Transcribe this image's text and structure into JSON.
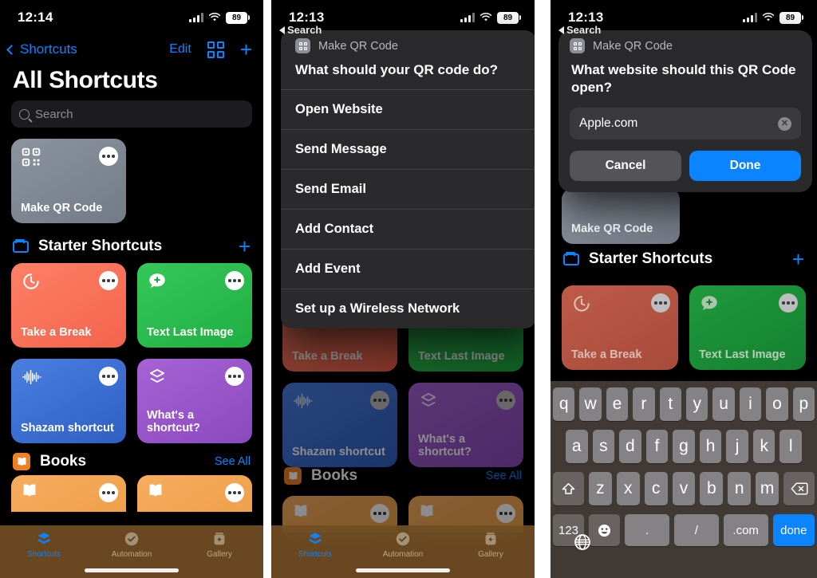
{
  "panels": [
    {
      "id": "panel-all-shortcuts",
      "status": {
        "time": "12:14",
        "battery": "89"
      },
      "nav": {
        "back_label": "Shortcuts",
        "edit_label": "Edit",
        "grid_icon": "grid-view-icon",
        "add_icon": "plus-icon"
      },
      "title": "All Shortcuts",
      "search_placeholder": "Search",
      "my_shortcuts": [
        {
          "label": "Make QR Code",
          "icon": "qr-code-icon",
          "color": "#7d8590"
        }
      ],
      "section_starter": {
        "title": "Starter Shortcuts",
        "icon": "folder-icon",
        "action_icon": "plus-icon"
      },
      "starter_shortcuts": [
        {
          "label": "Take a Break",
          "icon": "timer-icon",
          "color": "#fc7058"
        },
        {
          "label": "Text Last Image",
          "icon": "message-plus-icon",
          "color": "#2dbe4e"
        },
        {
          "label": "Shazam shortcut",
          "icon": "waveform-icon",
          "color": "#3b6fd4"
        },
        {
          "label": "What's a shortcut?",
          "icon": "layers-icon",
          "color": "#9a56c9"
        }
      ],
      "section_books": {
        "title": "Books",
        "icon": "books-app-icon",
        "see_all": "See All"
      },
      "books_shortcuts": [
        {
          "label": "",
          "color": "#f2a04a"
        },
        {
          "label": "",
          "color": "#f2a04a"
        }
      ],
      "tabs": [
        {
          "label": "Shortcuts",
          "icon": "shortcuts-tab-icon",
          "active": true
        },
        {
          "label": "Automation",
          "icon": "automation-tab-icon",
          "active": false
        },
        {
          "label": "Gallery",
          "icon": "gallery-tab-icon",
          "active": false
        }
      ]
    },
    {
      "id": "panel-action-sheet",
      "status": {
        "time": "12:13",
        "battery": "89"
      },
      "back_crumb": "Search",
      "sheet": {
        "app_name": "Make QR Code",
        "app_icon": "qr-code-icon",
        "question": "What should your QR code do?",
        "options": [
          "Open Website",
          "Send Message",
          "Send Email",
          "Add Contact",
          "Add Event",
          "Set up a Wireless Network"
        ]
      },
      "section_books": {
        "title": "Books",
        "see_all": "See All"
      },
      "starter_shortcuts": [
        {
          "label": "Take a Break",
          "color": "#fc7058"
        },
        {
          "label": "Text Last Image",
          "color": "#2dbe4e"
        },
        {
          "label": "Shazam shortcut",
          "color": "#3b6fd4"
        },
        {
          "label": "What's a shortcut?",
          "color": "#9a56c9"
        }
      ],
      "tabs": [
        {
          "label": "Shortcuts",
          "active": true
        },
        {
          "label": "Automation",
          "active": false
        },
        {
          "label": "Gallery",
          "active": false
        }
      ]
    },
    {
      "id": "panel-url-input",
      "status": {
        "time": "12:13",
        "battery": "89"
      },
      "back_crumb": "Search",
      "dialog": {
        "app_name": "Make QR Code",
        "app_icon": "qr-code-icon",
        "question": "What website should this QR Code open?",
        "input_value": "Apple.com",
        "clear_icon": "clear-field-icon",
        "cancel_label": "Cancel",
        "done_label": "Done"
      },
      "my_shortcuts": [
        {
          "label": "Make QR Code",
          "color": "#7d8590"
        }
      ],
      "section_starter": {
        "title": "Starter Shortcuts",
        "icon": "folder-icon",
        "action_icon": "plus-icon"
      },
      "starter_shortcuts": [
        {
          "label": "Take a Break",
          "icon": "timer-icon",
          "color": "#fc7058"
        },
        {
          "label": "Text Last Image",
          "icon": "message-plus-icon",
          "color": "#2dbe4e"
        }
      ],
      "keyboard": {
        "row1": [
          "q",
          "w",
          "e",
          "r",
          "t",
          "y",
          "u",
          "i",
          "o",
          "p"
        ],
        "row2": [
          "a",
          "s",
          "d",
          "f",
          "g",
          "h",
          "j",
          "k",
          "l"
        ],
        "row3": [
          "z",
          "x",
          "c",
          "v",
          "b",
          "n",
          "m"
        ],
        "shift_key": "shift-key-icon",
        "backspace_key": "backspace-key-icon",
        "numbers_key": "123",
        "emoji_key": "emoji-key-icon",
        "period_key": ".",
        "slash_key": "/",
        "dotcom_key": ".com",
        "done_key": "done",
        "globe_key": "globe-key-icon"
      }
    }
  ],
  "colors": {
    "accent_blue": "#0a84ff",
    "sheet_bg": "#2a2a2c",
    "page_bg": "#000000"
  }
}
